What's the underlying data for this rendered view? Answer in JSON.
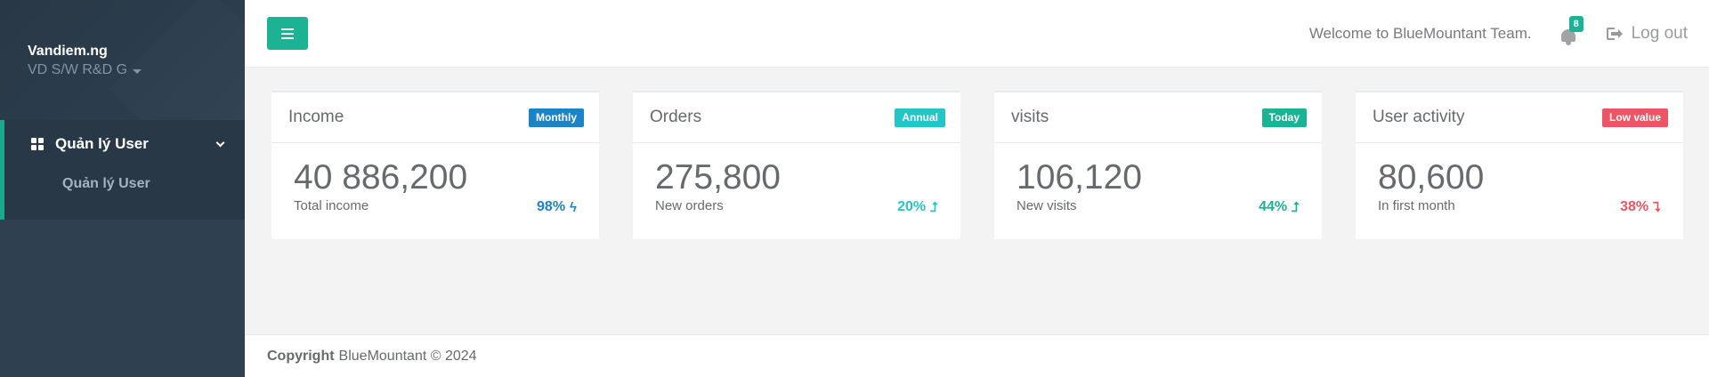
{
  "sidebar": {
    "profile": {
      "name": "Vandiem.ng",
      "role": "VD S/W R&D G"
    },
    "nav": {
      "section_label": "Quản lý User",
      "items": [
        {
          "label": "Quản lý User"
        }
      ]
    }
  },
  "topbar": {
    "welcome": "Welcome to BlueMountant Team.",
    "notification_count": "8",
    "logout_label": "Log out"
  },
  "cards": [
    {
      "title": "Income",
      "tag": "Monthly",
      "tag_color": "#1c84c6",
      "value": "40 886,200",
      "subtitle": "Total income",
      "stat": "98%",
      "stat_icon": "bolt-icon",
      "stat_glyph": "ϟ"
    },
    {
      "title": "Orders",
      "tag": "Annual",
      "tag_color": "#23c6c8",
      "value": "275,800",
      "subtitle": "New orders",
      "stat": "20%",
      "stat_icon": "level-up-icon",
      "stat_glyph": "⮥"
    },
    {
      "title": "visits",
      "tag": "Today",
      "tag_color": "#1ab394",
      "value": "106,120",
      "subtitle": "New visits",
      "stat": "44%",
      "stat_icon": "level-up-icon",
      "stat_glyph": "⮥"
    },
    {
      "title": "User activity",
      "tag": "Low value",
      "tag_color": "#ed5565",
      "value": "80,600",
      "subtitle": "In first month",
      "stat": "38%",
      "stat_icon": "level-down-icon",
      "stat_glyph": "⮧"
    }
  ],
  "footer": {
    "copyright_label": "Copyright",
    "text": "BlueMountant © 2024"
  }
}
